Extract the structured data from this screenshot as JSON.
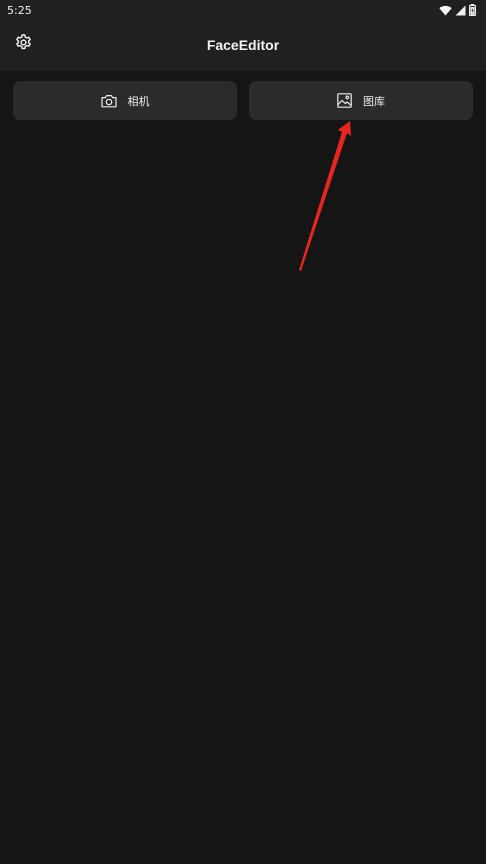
{
  "status_bar": {
    "time": "5:25",
    "icons": [
      "wifi-icon",
      "signal-icon",
      "battery-icon"
    ]
  },
  "app_bar": {
    "title": "FaceEditor",
    "settings_icon": "gear-icon"
  },
  "actions": {
    "camera_label": "相机",
    "camera_icon": "camera-icon",
    "gallery_label": "图库",
    "gallery_icon": "image-icon"
  },
  "colors": {
    "background": "#151515",
    "bar": "#202020",
    "button": "#2b2b2b",
    "annotation_arrow": "#e8261f"
  }
}
